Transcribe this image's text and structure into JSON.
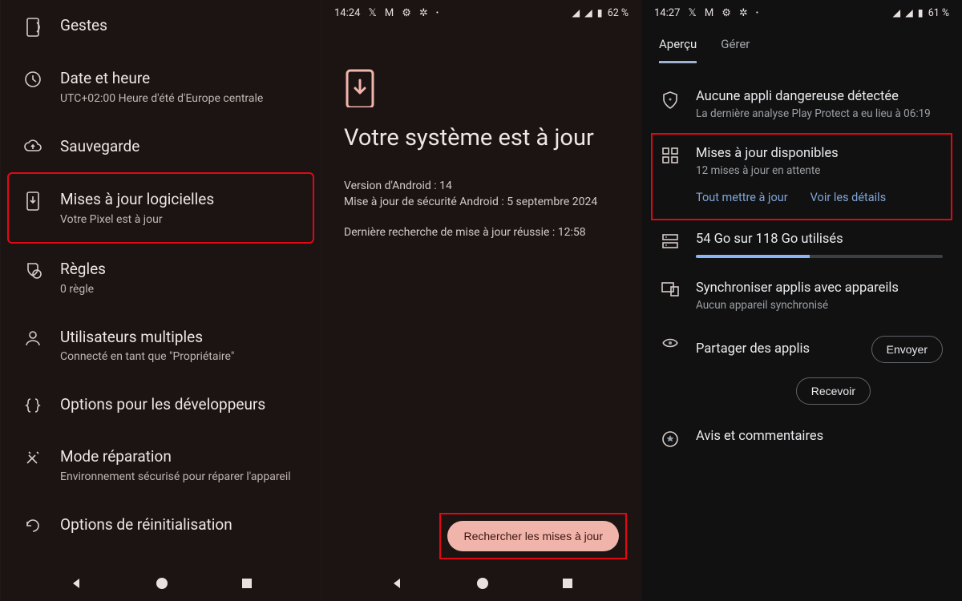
{
  "panel1": {
    "items": [
      {
        "title": "Gestes",
        "sub": ""
      },
      {
        "title": "Date et heure",
        "sub": "UTC+02:00 Heure d'été d'Europe centrale"
      },
      {
        "title": "Sauvegarde",
        "sub": ""
      },
      {
        "title": "Mises à jour logicielles",
        "sub": "Votre Pixel est à jour"
      },
      {
        "title": "Règles",
        "sub": "0 règle"
      },
      {
        "title": "Utilisateurs multiples",
        "sub": "Connecté en tant que \"Propriétaire\""
      },
      {
        "title": "Options pour les développeurs",
        "sub": ""
      },
      {
        "title": "Mode réparation",
        "sub": "Environnement sécurisé pour réparer l'appareil"
      },
      {
        "title": "Options de réinitialisation",
        "sub": ""
      }
    ]
  },
  "panel2": {
    "status_time": "14:24",
    "status_batt": "62 %",
    "title": "Votre système est à jour",
    "line_version": "Version d'Android : 14",
    "line_security": "Mise à jour de sécurité Android : 5 septembre 2024",
    "line_lastcheck": "Dernière recherche de mise à jour réussie : 12:58",
    "check_btn": "Rechercher les mises à jour"
  },
  "panel3": {
    "status_time": "14:27",
    "status_batt": "61 %",
    "tabs": {
      "overview": "Aperçu",
      "manage": "Gérer"
    },
    "protect": {
      "title": "Aucune appli dangereuse détectée",
      "sub": "La dernière analyse Play Protect a eu lieu à 06:19"
    },
    "updates": {
      "title": "Mises à jour disponibles",
      "sub": "12 mises à jour en attente",
      "all": "Tout mettre à jour",
      "details": "Voir les détails"
    },
    "storage": {
      "title": "54 Go sur 118 Go utilisés",
      "percent": 46
    },
    "sync": {
      "title": "Synchroniser applis avec appareils",
      "sub": "Aucun appareil synchronisé"
    },
    "share": {
      "title": "Partager des applis",
      "send": "Envoyer",
      "receive": "Recevoir"
    },
    "reviews": {
      "title": "Avis et commentaires"
    }
  }
}
